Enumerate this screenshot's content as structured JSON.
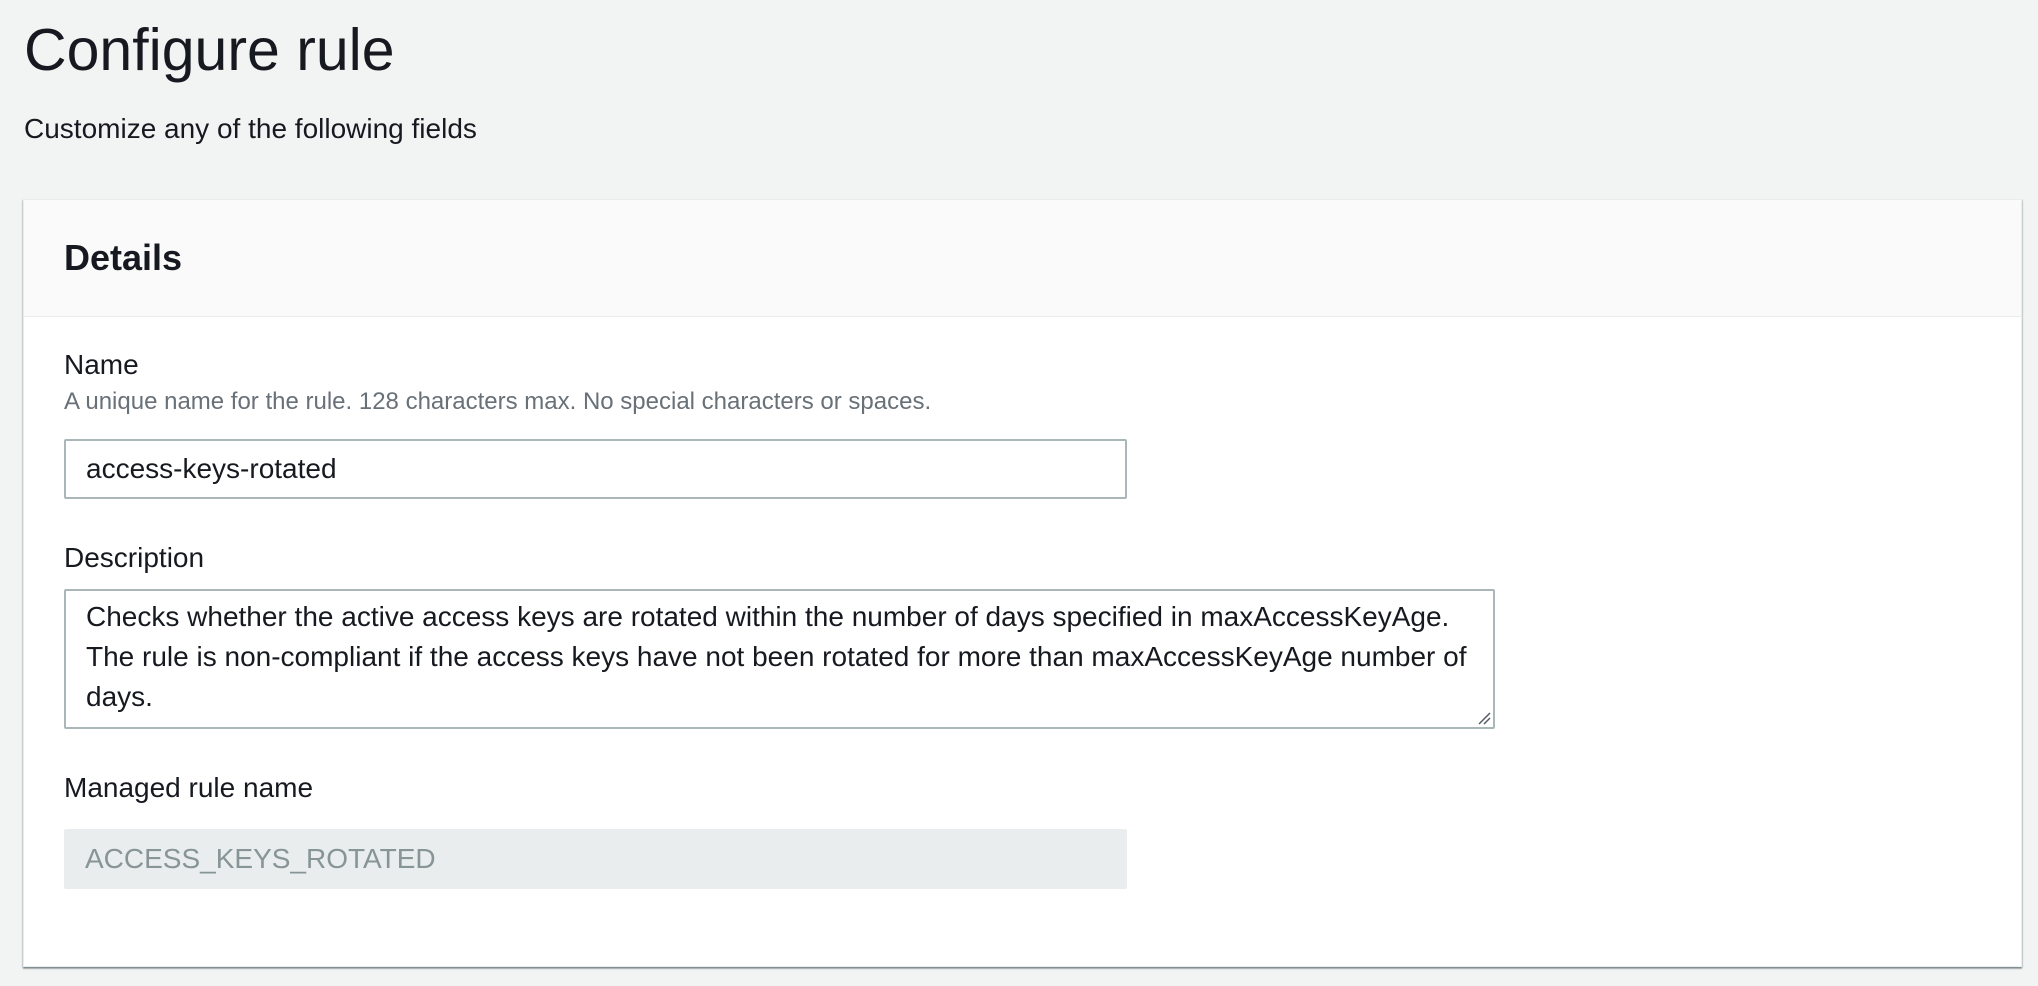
{
  "page": {
    "title": "Configure rule",
    "subtitle": "Customize any of the following fields"
  },
  "details": {
    "title": "Details",
    "name": {
      "label": "Name",
      "hint": "A unique name for the rule. 128 characters max. No special characters or spaces.",
      "value": "access-keys-rotated"
    },
    "description": {
      "label": "Description",
      "value": "Checks whether the active access keys are rotated within the number of days specified in maxAccessKeyAge. The rule is non-compliant if the access keys have not been rotated for more than maxAccessKeyAge number of days."
    },
    "managed_rule_name": {
      "label": "Managed rule name",
      "value": "ACCESS_KEYS_ROTATED"
    }
  },
  "icons": {
    "resize_grip": "resize-grip-icon"
  },
  "colors": {
    "background": "#f2f3f3",
    "panel": "#ffffff",
    "panel_header": "#fafafa",
    "input_border": "#aab7b8",
    "hint_text": "#687078",
    "disabled_bg": "#eaeded",
    "disabled_text": "#879596"
  }
}
